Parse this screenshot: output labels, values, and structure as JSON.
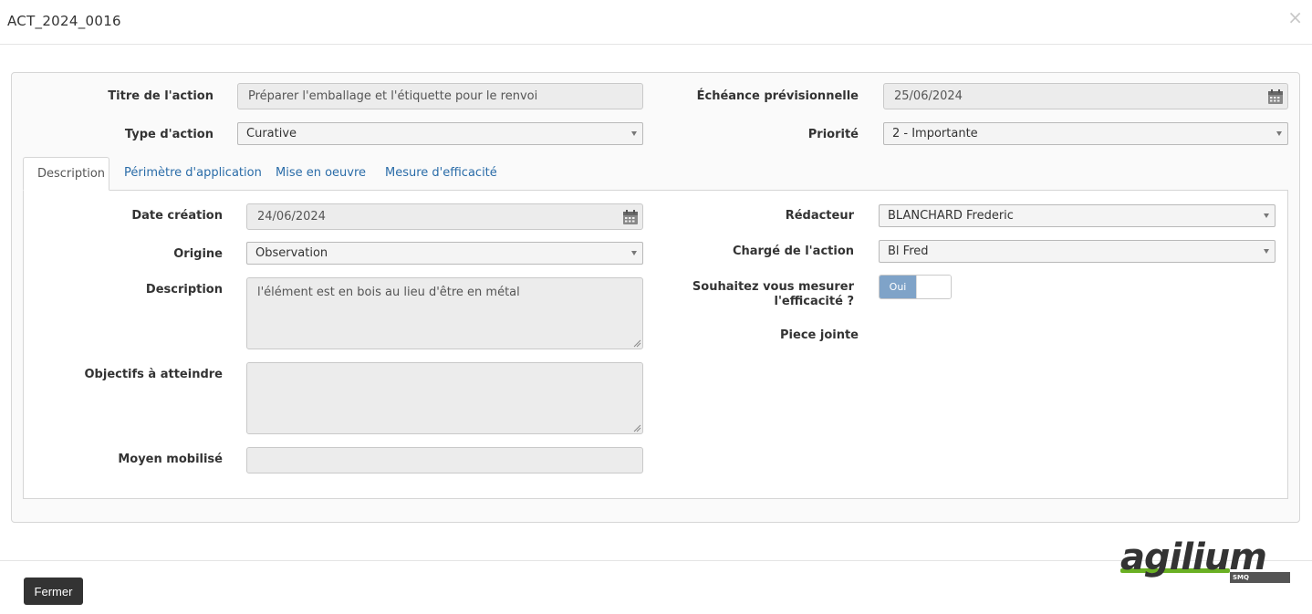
{
  "dialog": {
    "title": "ACT_2024_0016",
    "close_symbol": "×"
  },
  "header_form": {
    "titre_label": "Titre de l'action",
    "titre_value": "Préparer l'emballage et l'étiquette pour le renvoi",
    "type_label": "Type d'action",
    "type_value": "Curative",
    "echeance_label": "Échéance prévisionnelle",
    "echeance_value": "25/06/2024",
    "priorite_label": "Priorité",
    "priorite_value": "2 - Importante"
  },
  "tabs": [
    {
      "label": "Description",
      "active": true
    },
    {
      "label": "Périmètre d'application",
      "active": false
    },
    {
      "label": "Mise en oeuvre",
      "active": false
    },
    {
      "label": "Mesure d'efficacité",
      "active": false
    }
  ],
  "description_tab": {
    "date_creation_label": "Date création",
    "date_creation_value": "24/06/2024",
    "origine_label": "Origine",
    "origine_value": "Observation",
    "description_label": "Description",
    "description_value": "l'élément est en bois au lieu d'être en métal",
    "objectifs_label": "Objectifs à atteindre",
    "objectifs_value": "",
    "moyen_label": "Moyen mobilisé",
    "moyen_value": "",
    "redacteur_label": "Rédacteur",
    "redacteur_value": "BLANCHARD Frederic",
    "charge_label": "Chargé de l'action",
    "charge_value": "Bl Fred",
    "mesurer_label_line1": "Souhaitez vous mesurer",
    "mesurer_label_line2": "l'efficacité ?",
    "mesurer_toggle_on": "Oui",
    "mesurer_enabled": true,
    "piece_label": "Piece jointe"
  },
  "footer": {
    "close_button": "Fermer"
  },
  "logo": {
    "brand": "agilium",
    "tag": "SMQ",
    "brand_color": "#333333",
    "accent_color": "#6ab023"
  },
  "colors": {
    "link": "#2a6ca8",
    "toggle_on": "#7fa3c8",
    "button_dark": "#333333"
  }
}
